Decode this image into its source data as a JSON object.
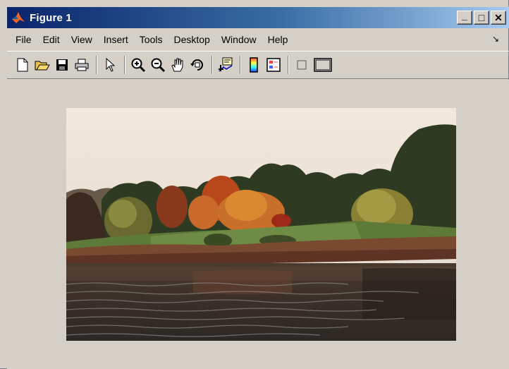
{
  "window": {
    "title": "Figure 1"
  },
  "title_controls": {
    "minimize": "_",
    "maximize": "□",
    "close": "✕"
  },
  "menu": [
    "File",
    "Edit",
    "View",
    "Insert",
    "Tools",
    "Desktop",
    "Window",
    "Help"
  ],
  "menu_dock_arrow": "↘",
  "toolbar": [
    "new-figure-icon",
    "open-file-icon",
    "save-icon",
    "print-icon",
    "edit-plot-pointer-icon",
    "zoom-in-icon",
    "zoom-out-icon",
    "pan-hand-icon",
    "rotate-3d-icon",
    "data-cursor-icon",
    "insert-colorbar-icon",
    "insert-legend-icon",
    "hide-plot-tools-icon",
    "show-plot-tools-icon"
  ],
  "colors": {
    "title_start": "#0a246a",
    "title_end": "#a6caf0",
    "chrome": "#d4d0c8"
  }
}
